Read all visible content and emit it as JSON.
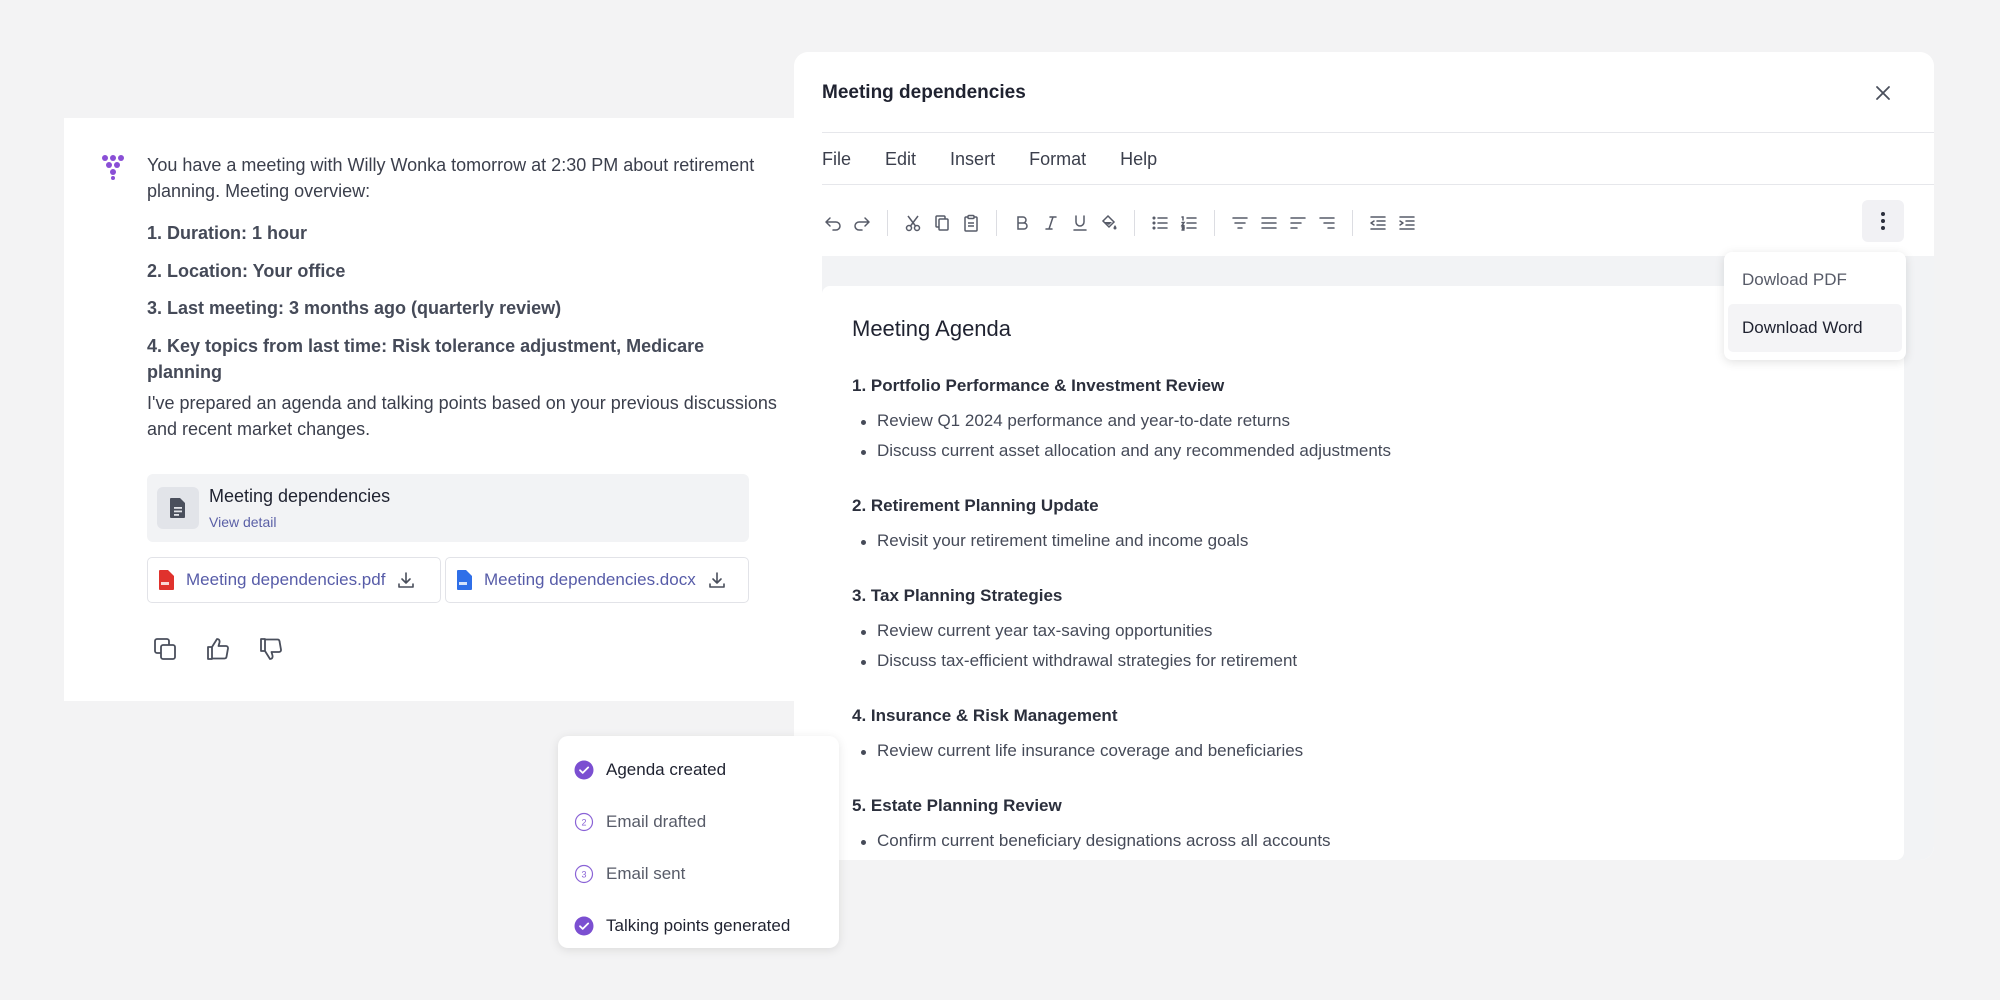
{
  "chat": {
    "intro": "You have a meeting with Willy Wonka tomorrow at 2:30 PM about retirement planning. Meeting overview:",
    "overview": [
      "1. Duration: 1 hour",
      "2. Location: Your office",
      "3. Last meeting: 3 months ago (quarterly review)",
      "4. Key topics from last time: Risk tolerance adjustment, Medicare planning"
    ],
    "prepared": "I've prepared an agenda and talking points based on your previous discussions and recent market changes.",
    "doc_card": {
      "title": "Meeting dependencies",
      "link": "View detail"
    },
    "files": [
      "Meeting dependencies.pdf",
      "Meeting dependencies.docx"
    ]
  },
  "editor": {
    "title": "Meeting dependencies",
    "menu": [
      "File",
      "Edit",
      "Insert",
      "Format",
      "Help"
    ],
    "dropdown": [
      "Dowload PDF",
      "Download Word"
    ],
    "document": {
      "heading": "Meeting Agenda",
      "sections": [
        {
          "title": "1. Portfolio Performance & Investment Review",
          "items": [
            "Review Q1 2024 performance and year-to-date returns",
            "Discuss current asset allocation and any recommended adjustments"
          ]
        },
        {
          "title": "2. Retirement Planning Update",
          "items": [
            "Revisit your retirement timeline and income goals"
          ]
        },
        {
          "title": "3. Tax Planning Strategies",
          "items": [
            "Review current year tax-saving opportunities",
            "Discuss tax-efficient withdrawal strategies for retirement"
          ]
        },
        {
          "title": "4. Insurance & Risk Management",
          "items": [
            "Review current life insurance coverage and beneficiaries"
          ]
        },
        {
          "title": "5. Estate Planning Review",
          "items": [
            "Confirm current beneficiary designations across all accounts"
          ]
        }
      ]
    }
  },
  "checklist": [
    {
      "label": "Agenda created",
      "status": "done"
    },
    {
      "label": "Email drafted",
      "status": "2"
    },
    {
      "label": "Email sent",
      "status": "3"
    },
    {
      "label": "Talking points generated",
      "status": "done"
    }
  ],
  "colors": {
    "accent": "#7b4fd1",
    "link": "#575ca8",
    "pdf": "#e0322d",
    "docx": "#2f6fe8"
  }
}
